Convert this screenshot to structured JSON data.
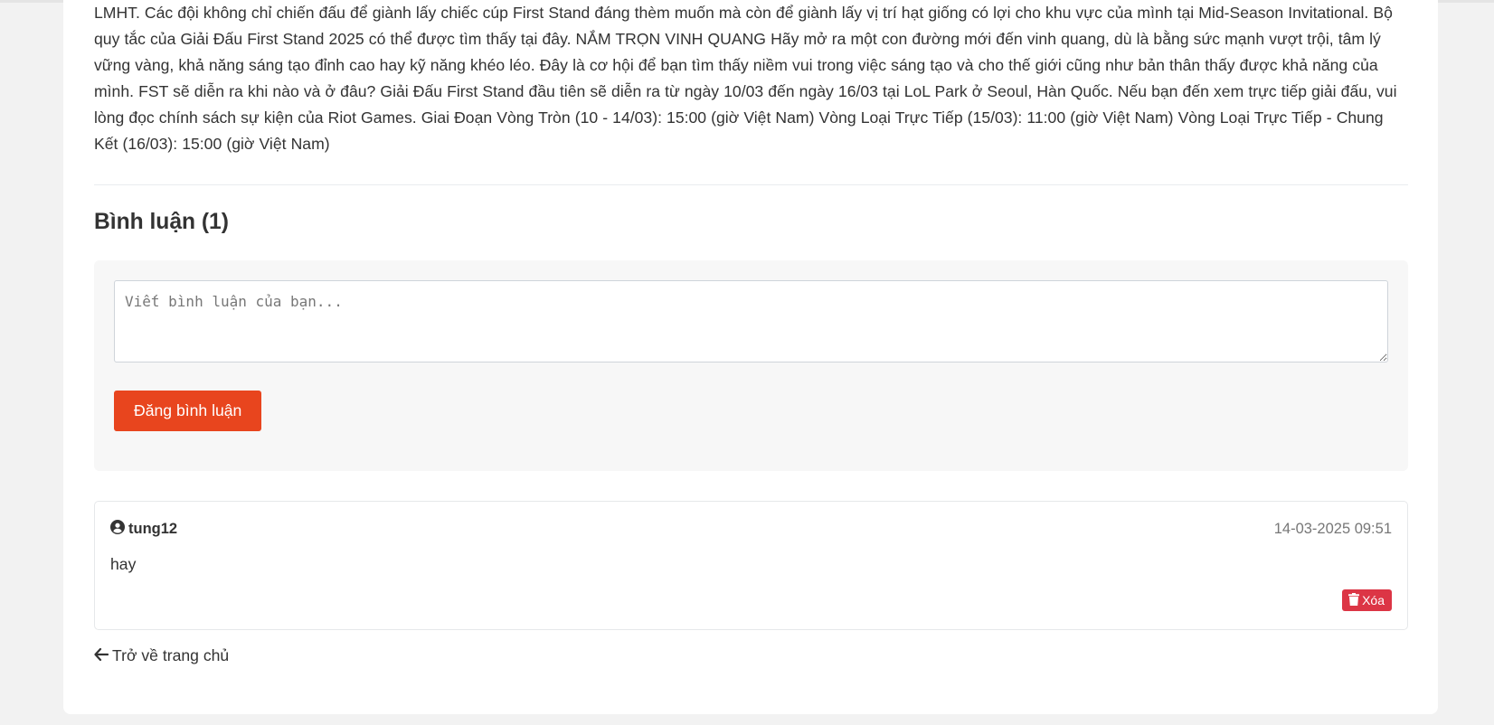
{
  "article": {
    "body": "LMHT. Các đội không chỉ chiến đấu để giành lấy chiếc cúp First Stand đáng thèm muốn mà còn để giành lấy vị trí hạt giống có lợi cho khu vực của mình tại Mid-Season Invitational. Bộ quy tắc của Giải Đấu First Stand 2025 có thể được tìm thấy tại đây. NẮM TRỌN VINH QUANG Hãy mở ra một con đường mới đến vinh quang, dù là bằng sức mạnh vượt trội, tâm lý vững vàng, khả năng sáng tạo đỉnh cao hay kỹ năng khéo léo. Đây là cơ hội để bạn tìm thấy niềm vui trong việc sáng tạo và cho thế giới cũng như bản thân thấy được khả năng của mình. FST sẽ diễn ra khi nào và ở đâu? Giải Đấu First Stand đầu tiên sẽ diễn ra từ ngày 10/03 đến ngày 16/03 tại LoL Park ở Seoul, Hàn Quốc. Nếu bạn đến xem trực tiếp giải đấu, vui lòng đọc chính sách sự kiện của Riot Games. Giai Đoạn Vòng Tròn (10 - 14/03): 15:00 (giờ Việt Nam) Vòng Loại Trực Tiếp (15/03): 11:00 (giờ Việt Nam) Vòng Loại Trực Tiếp - Chung Kết (16/03): 15:00 (giờ Việt Nam)"
  },
  "comments": {
    "title": "Bình luận (1)",
    "form": {
      "placeholder": "Viết bình luận của bạn...",
      "value": "",
      "submit_label": "Đăng bình luận"
    },
    "items": [
      {
        "author": "tung12",
        "timestamp": "14-03-2025 09:51",
        "text": "hay",
        "delete_label": "Xóa"
      }
    ]
  },
  "nav": {
    "back_label": "Trở về trang chủ"
  },
  "colors": {
    "page_background": "#f2f2f2",
    "primary_button": "#e8451e",
    "danger_button": "#dc3545",
    "text": "#333333",
    "muted_text": "#777777"
  },
  "icons": {
    "author": "user-circle-icon",
    "delete": "trash-icon",
    "back": "arrow-left-icon"
  }
}
